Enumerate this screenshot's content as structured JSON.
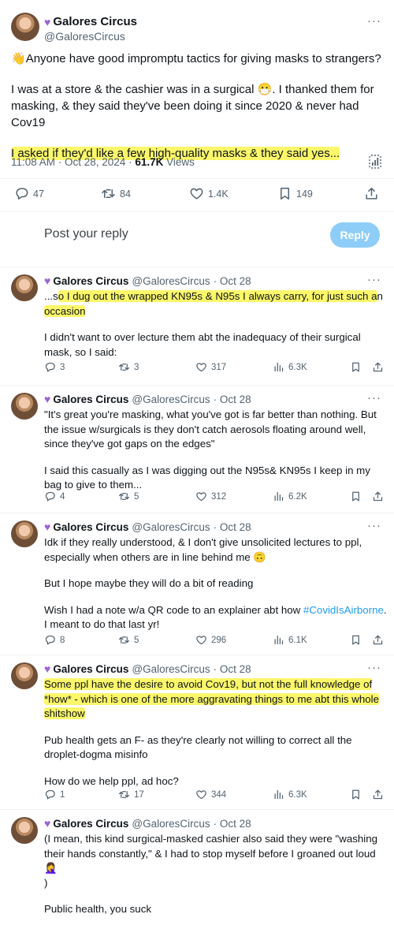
{
  "main_tweet": {
    "author_name": "Galores Circus",
    "author_handle": "@GaloresCircus",
    "para1": "Anyone have good impromptu tactics for giving masks to strangers?",
    "para1_emoji": "👋",
    "para2_a": "I was at a store & the cashier was in a surgical ",
    "para2_emoji": "😷",
    "para2_b": ". I thanked them for masking, & they said they've been doing it since 2020 & never had Cov19",
    "para3_highlight": "I asked if they'd like a few high-quality masks & they said yes...",
    "time": "11:08 AM · Oct 28, 2024 · ",
    "views_count": "61.7K",
    "views_label": " Views",
    "replies": "47",
    "reposts": "84",
    "likes": "1.4K",
    "bookmarks": "149"
  },
  "reply_box": {
    "placeholder": "Post your reply",
    "button": "Reply"
  },
  "replies": [
    {
      "name": "Galores Circus",
      "handle": "@GaloresCircus",
      "date": "· Oct 28",
      "p1_pre": "...s",
      "p1_hl": "o I dug out the wrapped KN95s & N95s I always carry, for just such a",
      "p1_post": "n",
      "p1_hl2": "occasion",
      "p2": "I didn't want to over lecture them abt the inadequacy of their surgical mask, so I said:",
      "stats": {
        "replies": "3",
        "reposts": "3",
        "likes": "317",
        "views": "6.3K"
      }
    },
    {
      "name": "Galores Circus",
      "handle": "@GaloresCircus",
      "date": "· Oct 28",
      "p1": "\"It's great you're masking, what you've got is far better than nothing. But the issue w/surgicals is they don't catch aerosols floating around well, since they've got gaps on the edges\"",
      "p2": "I said this casually as I was digging out the N95s& KN95s I keep in my bag to give to them...",
      "stats": {
        "replies": "4",
        "reposts": "5",
        "likes": "312",
        "views": "6.2K"
      }
    },
    {
      "name": "Galores Circus",
      "handle": "@GaloresCircus",
      "date": "· Oct 28",
      "p1": "Idk if they really understood, & I don't give unsolicited lectures to ppl, especially when others are in line behind me",
      "p1_emoji": "🙃",
      "p2": "But I hope maybe they will do a bit of reading",
      "p3_pre": "Wish I had a note w/a QR code to an explainer abt how ",
      "p3_link": "#CovidIsAirborne",
      "p3_post": ". I meant to do that last yr!",
      "stats": {
        "replies": "8",
        "reposts": "5",
        "likes": "296",
        "views": "6.1K"
      }
    },
    {
      "name": "Galores Circus",
      "handle": "@GaloresCircus",
      "date": "· Oct 28",
      "p1_hl": "Some ppl have the desire to avoid Cov19, but not the full knowledge of *how* -  which is one of the more aggravating things to me abt this whole shitshow",
      "p2": "Pub health gets an F- as they're clearly not willing to correct all the droplet-dogma misinfo",
      "p3": "How do we help ppl, ad hoc?",
      "stats": {
        "replies": "1",
        "reposts": "17",
        "likes": "344",
        "views": "6.3K"
      }
    },
    {
      "name": "Galores Circus",
      "handle": "@GaloresCircus",
      "date": "· Oct 28",
      "p1": "(I mean, this kind surgical-masked cashier also said they were \"washing their hands constantly,\" & I had to stop myself before I groaned out loud",
      "p1_emoji": "🤦‍♀️",
      "p1_end": ")",
      "p2": "Public health, you suck"
    }
  ],
  "icons": {
    "more": "more-dots-icon",
    "reply": "reply-icon",
    "repost": "repost-icon",
    "like": "heart-icon",
    "views": "views-bars-icon",
    "bookmark": "bookmark-icon",
    "share": "share-icon",
    "analytics": "analytics-icon",
    "badge": "purple-heart-icon"
  },
  "colors": {
    "highlight": "#fbf76a",
    "link": "#1d9bf0",
    "badge": "#9b64d8",
    "muted": "#536471",
    "reply_button": "#8ecdf8"
  }
}
